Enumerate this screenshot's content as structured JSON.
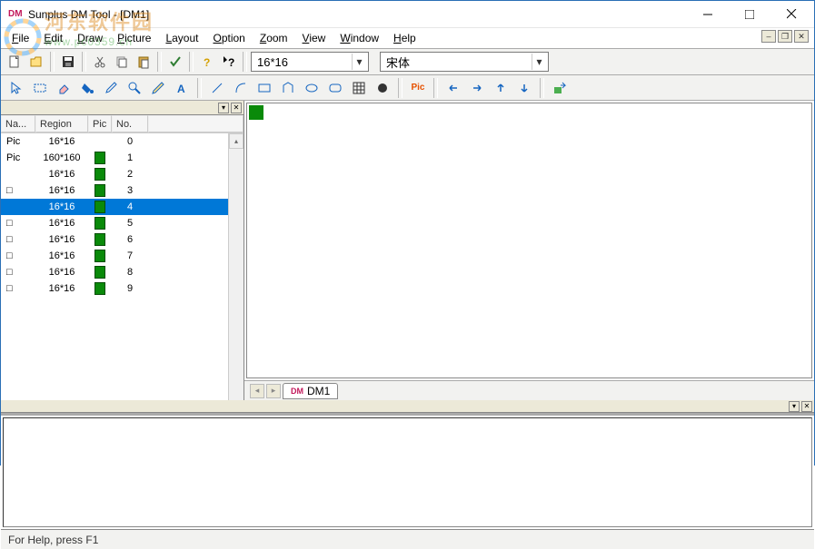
{
  "title": "Sunplus DM Tool - [DM1]",
  "watermark": {
    "line1": "河东软件园",
    "line2": "www.pc0359.cn"
  },
  "menu": {
    "file": "File",
    "edit": "Edit",
    "draw": "Draw",
    "picture": "Picture",
    "layout": "Layout",
    "option": "Option",
    "zoom": "Zoom",
    "view": "View",
    "window": "Window",
    "help": "Help"
  },
  "combo_size": "16*16",
  "combo_font": "宋体",
  "list": {
    "headers": {
      "name": "Na...",
      "region": "Region",
      "pic": "Pic",
      "no": "No."
    },
    "rows": [
      {
        "name": "Pic",
        "region": "16*16",
        "pic": false,
        "no": "0"
      },
      {
        "name": "Pic",
        "region": "160*160",
        "pic": true,
        "no": "1"
      },
      {
        "name": "",
        "region": "16*16",
        "pic": true,
        "no": "2"
      },
      {
        "name": "□",
        "region": "16*16",
        "pic": true,
        "no": "3"
      },
      {
        "name": "",
        "region": "16*16",
        "pic": true,
        "no": "4",
        "sel": true
      },
      {
        "name": "□",
        "region": "16*16",
        "pic": true,
        "no": "5"
      },
      {
        "name": "□",
        "region": "16*16",
        "pic": true,
        "no": "6"
      },
      {
        "name": "□",
        "region": "16*16",
        "pic": true,
        "no": "7"
      },
      {
        "name": "□",
        "region": "16*16",
        "pic": true,
        "no": "8"
      },
      {
        "name": "□",
        "region": "16*16",
        "pic": true,
        "no": "9"
      }
    ]
  },
  "tab_label": "DM1",
  "status": "For Help, press F1"
}
